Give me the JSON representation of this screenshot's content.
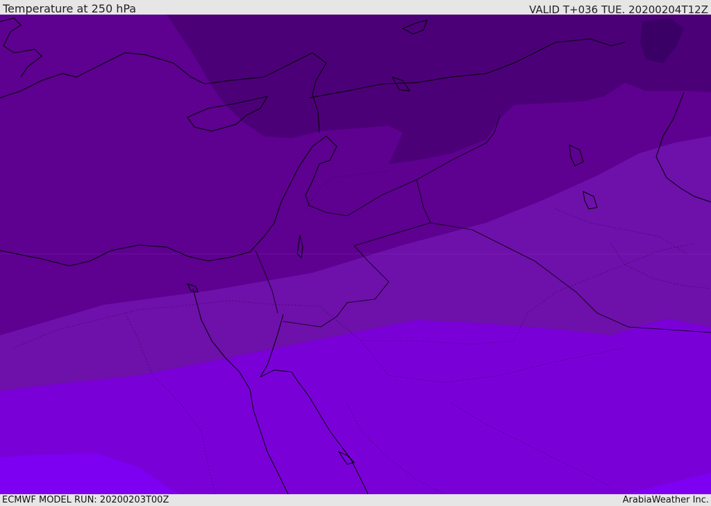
{
  "header": {
    "title": "Temperature at 250 hPa",
    "valid": "VALID T+036 TUE. 20200204T12Z"
  },
  "footer": {
    "model_run": "ECMWF MODEL RUN: 20200203T00Z",
    "credit": "ArabiaWeather Inc."
  },
  "map": {
    "field": "temperature-250hPa",
    "region": "eastern-mediterranean-middle-east",
    "colors": {
      "band_coldest": "#3a0066",
      "band_cold": "#4c0078",
      "band_mid": "#5e0090",
      "band_mild": "#6e10aa",
      "band_warm": "#7a00d8",
      "band_warmest": "#7d00f2",
      "coastline": "#000000",
      "border_dotted": "#2a0050"
    }
  }
}
